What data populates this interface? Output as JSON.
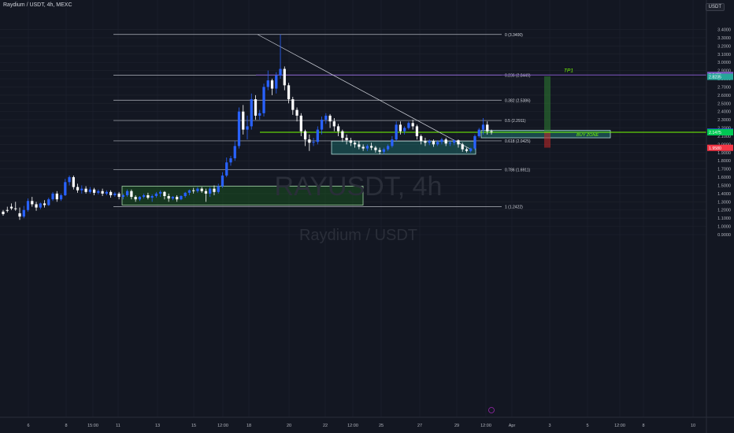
{
  "header": {
    "symbol_title": "Raydium / USDT, 4h, MEXC",
    "quote_badge": "USDT"
  },
  "watermark": {
    "ticker": "RAYUSDT, 4h",
    "name": "Raydium / USDT"
  },
  "colors": {
    "background": "#131722",
    "grid": "#1e222d",
    "bull_candle": "#2962ff",
    "bear_candle": "#ffffff",
    "fib_line": "#b2b5be",
    "tp_line": "#7e57c2",
    "buy_line": "#76ff03",
    "zone_green": "#1b5e20",
    "zone_teal": "#26a69a",
    "target_green": "#2e7d32",
    "stop_red": "#c62828"
  },
  "chart_data": {
    "type": "candlestick",
    "y_axis_ticks": [
      "3.4000",
      "3.3000",
      "3.2000",
      "3.1000",
      "3.0000",
      "2.9000",
      "2.8000",
      "2.7000",
      "2.6000",
      "2.5000",
      "2.4000",
      "2.3000",
      "2.2000",
      "2.1000",
      "2.0000",
      "1.9000",
      "1.8000",
      "1.7000",
      "1.6000",
      "1.5000",
      "1.4000",
      "1.3000",
      "1.2000",
      "1.1000",
      "1.0000",
      "0.9000"
    ],
    "ylim": [
      0.85,
      3.47
    ],
    "x_axis_ticks": [
      "6",
      "8",
      "15:00",
      "11",
      "13",
      "15",
      "12:00",
      "18",
      "20",
      "22",
      "12:00",
      "25",
      "27",
      "29",
      "12:00",
      "Apr",
      "3",
      "5",
      "12:00",
      "8",
      "10"
    ],
    "fib_levels": [
      {
        "label": "0 (3.3400)",
        "value": 3.34
      },
      {
        "label": "0.236 (2.8449)",
        "value": 2.8449
      },
      {
        "label": "0.382 (2.5386)",
        "value": 2.5386
      },
      {
        "label": "0.5 (2.2911)",
        "value": 2.2911
      },
      {
        "label": "0.618 (2.0425)",
        "value": 2.0425
      },
      {
        "label": "0.786 (1.6911)",
        "value": 1.6911
      },
      {
        "label": "1 (1.2422)",
        "value": 1.2422
      }
    ],
    "price_labels": [
      {
        "text": "2.8458",
        "value": 2.8458,
        "color": "#7e57c2"
      },
      {
        "text": "2.8235",
        "value": 2.8235,
        "color": "#26a69a"
      },
      {
        "text": "05:43:08",
        "value": 2.15,
        "color": "#2962ff"
      },
      {
        "text": "2.1538",
        "value": 2.1538,
        "color": "#2962ff"
      },
      {
        "text": "2.1475",
        "value": 2.1475,
        "color": "#00c853"
      },
      {
        "text": "1.9580",
        "value": 1.958,
        "color": "#f23645"
      }
    ],
    "annotations": {
      "tp_label": "TP1",
      "buy_zone_label": "BUY ZONE",
      "tp_price": 2.8458,
      "buy_price": 2.1475
    },
    "candles": [
      [
        1.18,
        1.2,
        1.15,
        1.13
      ],
      [
        1.2,
        1.24,
        1.19,
        1.17
      ],
      [
        1.24,
        1.28,
        1.22,
        1.2
      ],
      [
        1.22,
        1.3,
        1.21,
        1.19
      ],
      [
        1.16,
        1.23,
        1.12,
        1.08
      ],
      [
        1.12,
        1.25,
        1.2,
        1.1
      ],
      [
        1.2,
        1.34,
        1.31,
        1.18
      ],
      [
        1.31,
        1.36,
        1.27,
        1.24
      ],
      [
        1.27,
        1.3,
        1.23,
        1.19
      ],
      [
        1.23,
        1.29,
        1.28,
        1.21
      ],
      [
        1.28,
        1.32,
        1.26,
        1.23
      ],
      [
        1.26,
        1.35,
        1.33,
        1.25
      ],
      [
        1.33,
        1.42,
        1.4,
        1.31
      ],
      [
        1.4,
        1.43,
        1.33,
        1.3
      ],
      [
        1.33,
        1.4,
        1.38,
        1.31
      ],
      [
        1.38,
        1.58,
        1.54,
        1.37
      ],
      [
        1.54,
        1.62,
        1.6,
        1.5
      ],
      [
        1.6,
        1.62,
        1.48,
        1.45
      ],
      [
        1.48,
        1.52,
        1.44,
        1.41
      ],
      [
        1.44,
        1.5,
        1.46,
        1.4
      ],
      [
        1.46,
        1.49,
        1.42,
        1.4
      ],
      [
        1.42,
        1.48,
        1.45,
        1.4
      ],
      [
        1.45,
        1.47,
        1.41,
        1.38
      ],
      [
        1.41,
        1.45,
        1.43,
        1.39
      ],
      [
        1.43,
        1.46,
        1.4,
        1.37
      ],
      [
        1.4,
        1.44,
        1.42,
        1.38
      ],
      [
        1.42,
        1.44,
        1.38,
        1.35
      ],
      [
        1.38,
        1.42,
        1.4,
        1.36
      ],
      [
        1.4,
        1.42,
        1.36,
        1.33
      ],
      [
        1.36,
        1.4,
        1.38,
        1.33
      ],
      [
        1.38,
        1.45,
        1.43,
        1.36
      ],
      [
        1.43,
        1.45,
        1.36,
        1.33
      ],
      [
        1.36,
        1.38,
        1.33,
        1.3
      ],
      [
        1.33,
        1.37,
        1.36,
        1.31
      ],
      [
        1.36,
        1.4,
        1.38,
        1.34
      ],
      [
        1.38,
        1.41,
        1.35,
        1.33
      ],
      [
        1.35,
        1.39,
        1.37,
        1.3
      ],
      [
        1.37,
        1.42,
        1.4,
        1.35
      ],
      [
        1.4,
        1.44,
        1.42,
        1.36
      ],
      [
        1.42,
        1.43,
        1.37,
        1.33
      ],
      [
        1.37,
        1.4,
        1.34,
        1.3
      ],
      [
        1.34,
        1.37,
        1.36,
        1.32
      ],
      [
        1.36,
        1.38,
        1.33,
        1.3
      ],
      [
        1.33,
        1.38,
        1.37,
        1.32
      ],
      [
        1.37,
        1.42,
        1.41,
        1.35
      ],
      [
        1.41,
        1.45,
        1.44,
        1.38
      ],
      [
        1.44,
        1.47,
        1.43,
        1.4
      ],
      [
        1.43,
        1.48,
        1.46,
        1.41
      ],
      [
        1.46,
        1.48,
        1.43,
        1.41
      ],
      [
        1.43,
        1.46,
        1.4,
        1.3
      ],
      [
        1.4,
        1.48,
        1.46,
        1.36
      ],
      [
        1.46,
        1.5,
        1.42,
        1.38
      ],
      [
        1.42,
        1.52,
        1.49,
        1.4
      ],
      [
        1.49,
        1.66,
        1.62,
        1.47
      ],
      [
        1.62,
        1.84,
        1.78,
        1.6
      ],
      [
        1.78,
        1.86,
        1.83,
        1.74
      ],
      [
        1.83,
        2.04,
        1.98,
        1.8
      ],
      [
        1.98,
        2.45,
        2.4,
        1.95
      ],
      [
        2.4,
        2.48,
        2.18,
        2.12
      ],
      [
        2.18,
        2.35,
        2.22,
        2.06
      ],
      [
        2.22,
        2.62,
        2.55,
        2.18
      ],
      [
        2.55,
        2.6,
        2.35,
        2.3
      ],
      [
        2.35,
        2.42,
        2.38,
        2.3
      ],
      [
        2.38,
        2.74,
        2.7,
        2.34
      ],
      [
        2.7,
        2.9,
        2.78,
        2.66
      ],
      [
        2.78,
        2.8,
        2.68,
        2.6
      ],
      [
        2.68,
        2.88,
        2.84,
        2.62
      ],
      [
        2.84,
        3.34,
        2.92,
        2.8
      ],
      [
        2.92,
        2.95,
        2.72,
        2.66
      ],
      [
        2.72,
        2.75,
        2.55,
        2.5
      ],
      [
        2.55,
        2.58,
        2.42,
        2.36
      ],
      [
        2.42,
        2.45,
        2.35,
        2.28
      ],
      [
        2.35,
        2.38,
        2.16,
        2.1
      ],
      [
        2.16,
        2.18,
        2.06,
        1.98
      ],
      [
        2.06,
        2.12,
        2.02,
        1.92
      ],
      [
        2.02,
        2.08,
        2.03,
        1.98
      ],
      [
        2.03,
        2.22,
        2.18,
        2.0
      ],
      [
        2.18,
        2.34,
        2.3,
        2.12
      ],
      [
        2.3,
        2.38,
        2.35,
        2.25
      ],
      [
        2.35,
        2.37,
        2.28,
        2.2
      ],
      [
        2.28,
        2.32,
        2.22,
        2.16
      ],
      [
        2.22,
        2.25,
        2.16,
        2.1
      ],
      [
        2.16,
        2.18,
        2.08,
        2.03
      ],
      [
        2.08,
        2.12,
        2.05,
        2.0
      ],
      [
        2.05,
        2.08,
        2.02,
        1.98
      ],
      [
        2.02,
        2.05,
        2.0,
        1.96
      ],
      [
        2.0,
        2.04,
        1.97,
        1.94
      ],
      [
        1.97,
        2.0,
        1.95,
        1.92
      ],
      [
        1.95,
        2.0,
        1.98,
        1.92
      ],
      [
        1.98,
        2.02,
        1.96,
        1.93
      ],
      [
        1.96,
        1.98,
        1.93,
        1.9
      ],
      [
        1.93,
        1.96,
        1.91,
        1.88
      ],
      [
        1.91,
        1.96,
        1.94,
        1.88
      ],
      [
        1.94,
        2.0,
        1.98,
        1.92
      ],
      [
        1.98,
        2.1,
        2.06,
        1.96
      ],
      [
        2.06,
        2.28,
        2.24,
        2.04
      ],
      [
        2.24,
        2.28,
        2.16,
        2.12
      ],
      [
        2.16,
        2.22,
        2.2,
        2.12
      ],
      [
        2.2,
        2.28,
        2.26,
        2.18
      ],
      [
        2.26,
        2.3,
        2.22,
        2.18
      ],
      [
        2.22,
        2.24,
        2.1,
        2.06
      ],
      [
        2.1,
        2.12,
        2.04,
        2.0
      ],
      [
        2.04,
        2.08,
        2.02,
        1.98
      ],
      [
        2.02,
        2.06,
        2.04,
        1.99
      ],
      [
        2.04,
        2.06,
        2.0,
        1.97
      ],
      [
        2.0,
        2.05,
        2.03,
        1.98
      ],
      [
        2.03,
        2.08,
        2.06,
        2.0
      ],
      [
        2.06,
        2.08,
        2.01,
        1.98
      ],
      [
        2.01,
        2.04,
        2.02,
        1.98
      ],
      [
        2.02,
        2.06,
        2.05,
        1.99
      ],
      [
        2.05,
        2.06,
        2.0,
        1.96
      ],
      [
        2.0,
        2.02,
        1.94,
        1.91
      ],
      [
        1.94,
        1.96,
        1.92,
        1.9
      ],
      [
        1.92,
        1.96,
        1.95,
        1.9
      ],
      [
        1.95,
        2.12,
        2.1,
        1.93
      ],
      [
        2.1,
        2.2,
        2.18,
        2.08
      ],
      [
        2.18,
        2.32,
        2.24,
        2.12
      ],
      [
        2.24,
        2.28,
        2.16,
        2.12
      ],
      [
        2.16,
        2.18,
        2.15,
        2.12
      ]
    ]
  }
}
